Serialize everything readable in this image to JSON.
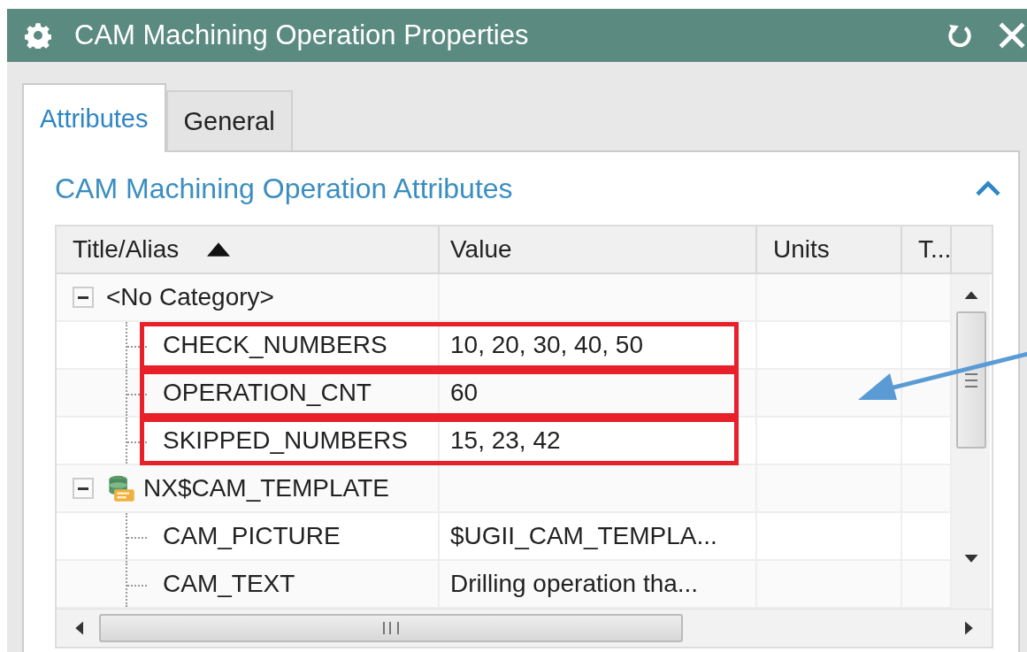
{
  "window": {
    "title": "CAM Machining Operation Properties"
  },
  "tabs": [
    {
      "label": "Attributes",
      "selected": true
    },
    {
      "label": "General",
      "selected": false
    }
  ],
  "section": {
    "title": "CAM Machining Operation Attributes",
    "expanded": true
  },
  "table": {
    "columns": [
      {
        "label": "Title/Alias",
        "sorted": true
      },
      {
        "label": "Value"
      },
      {
        "label": "Units"
      },
      {
        "label": "T..."
      }
    ],
    "rows": [
      {
        "title": "<No Category>",
        "kind": "group",
        "expanded": true,
        "children": [
          {
            "title": "CHECK_NUMBERS",
            "value": "10, 20, 30, 40, 50",
            "highlighted": true
          },
          {
            "title": "OPERATION_CNT",
            "value": "60",
            "highlighted": true
          },
          {
            "title": "SKIPPED_NUMBERS",
            "value": "15, 23, 42",
            "highlighted": true
          }
        ]
      },
      {
        "title": "NX$CAM_TEMPLATE",
        "kind": "template-group",
        "expanded": true,
        "children": [
          {
            "title": "CAM_PICTURE",
            "value": "$UGII_CAM_TEMPLA...",
            "highlighted": false
          },
          {
            "title": "CAM_TEXT",
            "value": "Drilling operation tha...",
            "highlighted": false
          }
        ]
      }
    ]
  }
}
